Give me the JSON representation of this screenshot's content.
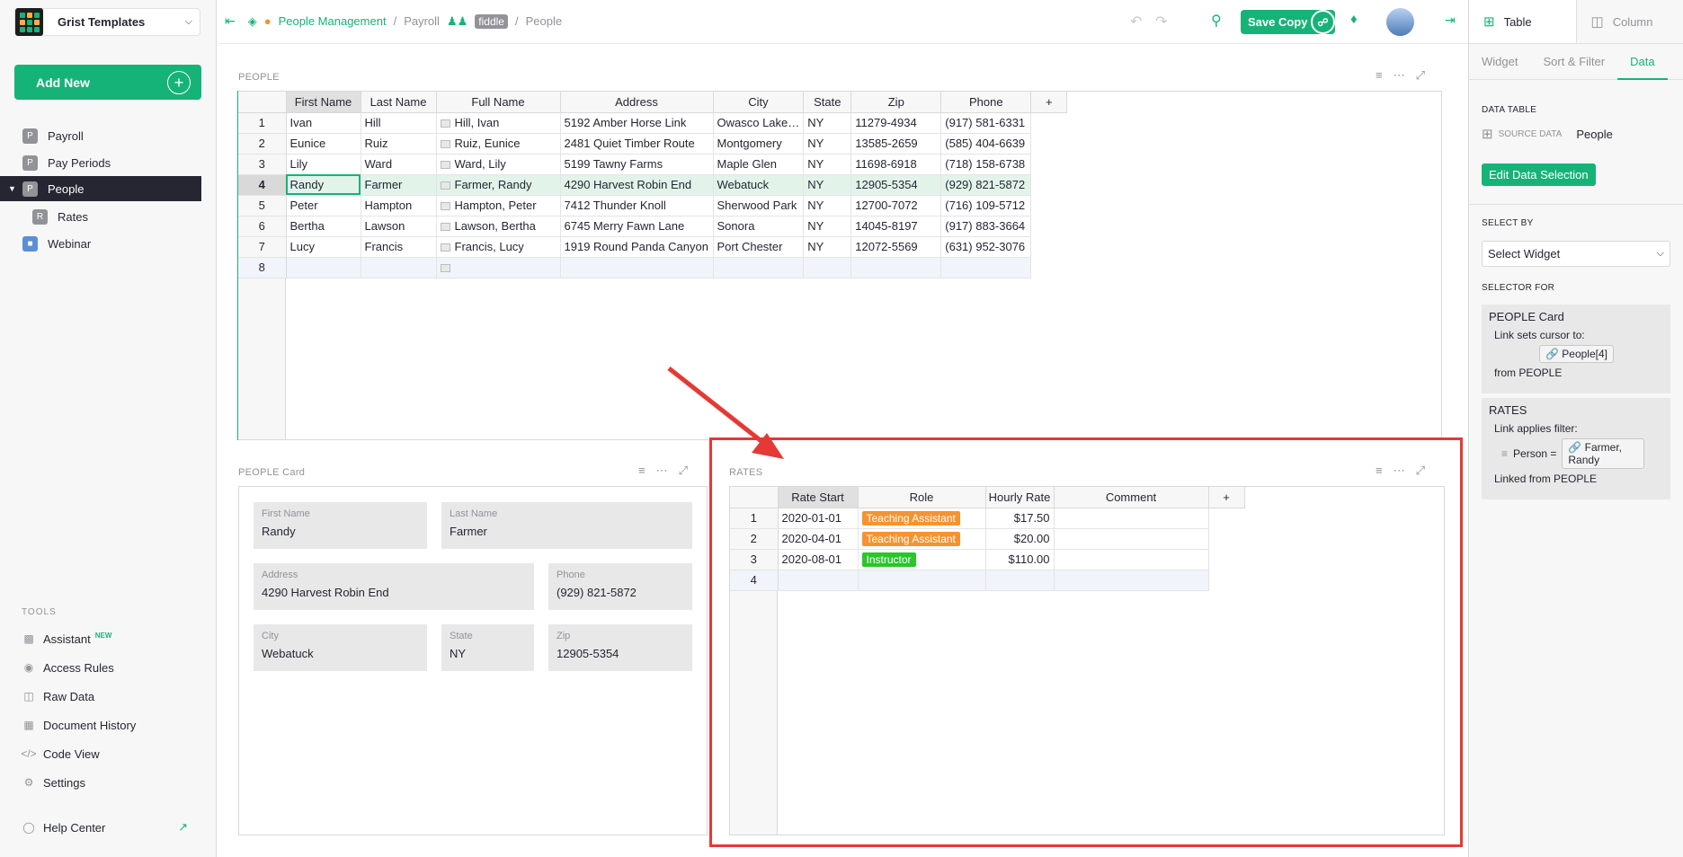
{
  "org": {
    "name": "Grist Templates"
  },
  "add_new": {
    "label": "Add New"
  },
  "pages": [
    {
      "icon": "P",
      "label": "Payroll"
    },
    {
      "icon": "P",
      "label": "Pay Periods"
    },
    {
      "icon": "P",
      "label": "People"
    },
    {
      "icon": "R",
      "label": "Rates"
    },
    {
      "icon": "webinar-icon",
      "label": "Webinar"
    }
  ],
  "tools": {
    "title": "TOOLS",
    "items": [
      {
        "label": "Assistant",
        "badge": "NEW"
      },
      {
        "label": "Access Rules"
      },
      {
        "label": "Raw Data"
      },
      {
        "label": "Document History"
      },
      {
        "label": "Code View"
      },
      {
        "label": "Settings"
      }
    ],
    "help": "Help Center"
  },
  "breadcrumb": {
    "doc": "People Management",
    "page": "Payroll",
    "mode": "fiddle",
    "section": "People"
  },
  "topbar": {
    "save_copy": "Save Copy"
  },
  "right_panel": {
    "tab_table": "Table",
    "tab_column": "Column",
    "subtabs": [
      "Widget",
      "Sort & Filter",
      "Data"
    ],
    "data_table_label": "DATA TABLE",
    "source_data_label": "SOURCE DATA",
    "source_data_value": "People",
    "edit_button": "Edit Data Selection",
    "select_by_label": "SELECT BY",
    "select_by_value": "Select Widget",
    "selector_for_label": "SELECTOR FOR",
    "selector1": {
      "title": "PEOPLE Card",
      "line1": "Link sets cursor to:",
      "chip": "People[4]",
      "line2": "from PEOPLE"
    },
    "selector2": {
      "title": "RATES",
      "line1": "Link applies filter:",
      "field": "Person =",
      "chip": "Farmer, Randy",
      "line2": "Linked from PEOPLE"
    }
  },
  "people": {
    "title": "PEOPLE",
    "add_col": "+",
    "columns": [
      "First Name",
      "Last Name",
      "Full Name",
      "Address",
      "City",
      "State",
      "Zip",
      "Phone"
    ],
    "rows": [
      [
        "1",
        "Ivan",
        "Hill",
        "Hill, Ivan",
        "5192 Amber Horse Link",
        "Owasco Lake…",
        "NY",
        "11279-4934",
        "(917) 581-6331"
      ],
      [
        "2",
        "Eunice",
        "Ruiz",
        "Ruiz, Eunice",
        "2481 Quiet Timber Route",
        "Montgomery",
        "NY",
        "13585-2659",
        "(585) 404-6639"
      ],
      [
        "3",
        "Lily",
        "Ward",
        "Ward, Lily",
        "5199 Tawny Farms",
        "Maple Glen",
        "NY",
        "11698-6918",
        "(718) 158-6738"
      ],
      [
        "4",
        "Randy",
        "Farmer",
        "Farmer, Randy",
        "4290 Harvest Robin End",
        "Webatuck",
        "NY",
        "12905-5354",
        "(929) 821-5872"
      ],
      [
        "5",
        "Peter",
        "Hampton",
        "Hampton, Peter",
        "7412 Thunder Knoll",
        "Sherwood Park",
        "NY",
        "12700-7072",
        "(716) 109-5712"
      ],
      [
        "6",
        "Bertha",
        "Lawson",
        "Lawson, Bertha",
        "6745 Merry Fawn Lane",
        "Sonora",
        "NY",
        "14045-8197",
        "(917) 883-3664"
      ],
      [
        "7",
        "Lucy",
        "Francis",
        "Francis, Lucy",
        "1919 Round Panda Canyon",
        "Port Chester",
        "NY",
        "12072-5569",
        "(631) 952-3076"
      ],
      [
        "8",
        "",
        "",
        "",
        "",
        "",
        "",
        "",
        ""
      ]
    ]
  },
  "card": {
    "title": "PEOPLE Card",
    "fields": [
      {
        "label": "First Name",
        "value": "Randy"
      },
      {
        "label": "Last Name",
        "value": "Farmer"
      },
      {
        "label": "Address",
        "value": "4290 Harvest Robin End"
      },
      {
        "label": "Phone",
        "value": "(929) 821-5872"
      },
      {
        "label": "City",
        "value": "Webatuck"
      },
      {
        "label": "State",
        "value": "NY"
      },
      {
        "label": "Zip",
        "value": "12905-5354"
      }
    ]
  },
  "rates": {
    "title": "RATES",
    "add_col": "+",
    "columns": [
      "Rate Start",
      "Role",
      "Hourly Rate",
      "Comment"
    ],
    "rows": [
      {
        "n": "1",
        "start": "2020-01-01",
        "role": "Teaching Assistant",
        "role_color": "#f59331",
        "rate": "$17.50",
        "comment": ""
      },
      {
        "n": "2",
        "start": "2020-04-01",
        "role": "Teaching Assistant",
        "role_color": "#f59331",
        "rate": "$20.00",
        "comment": ""
      },
      {
        "n": "3",
        "start": "2020-08-01",
        "role": "Instructor",
        "role_color": "#2bc42b",
        "rate": "$110.00",
        "comment": ""
      },
      {
        "n": "4",
        "start": "",
        "role": "",
        "role_color": "",
        "rate": "",
        "comment": ""
      }
    ]
  },
  "colors": {
    "accent": "#16b378",
    "highlight": "#e53935"
  }
}
